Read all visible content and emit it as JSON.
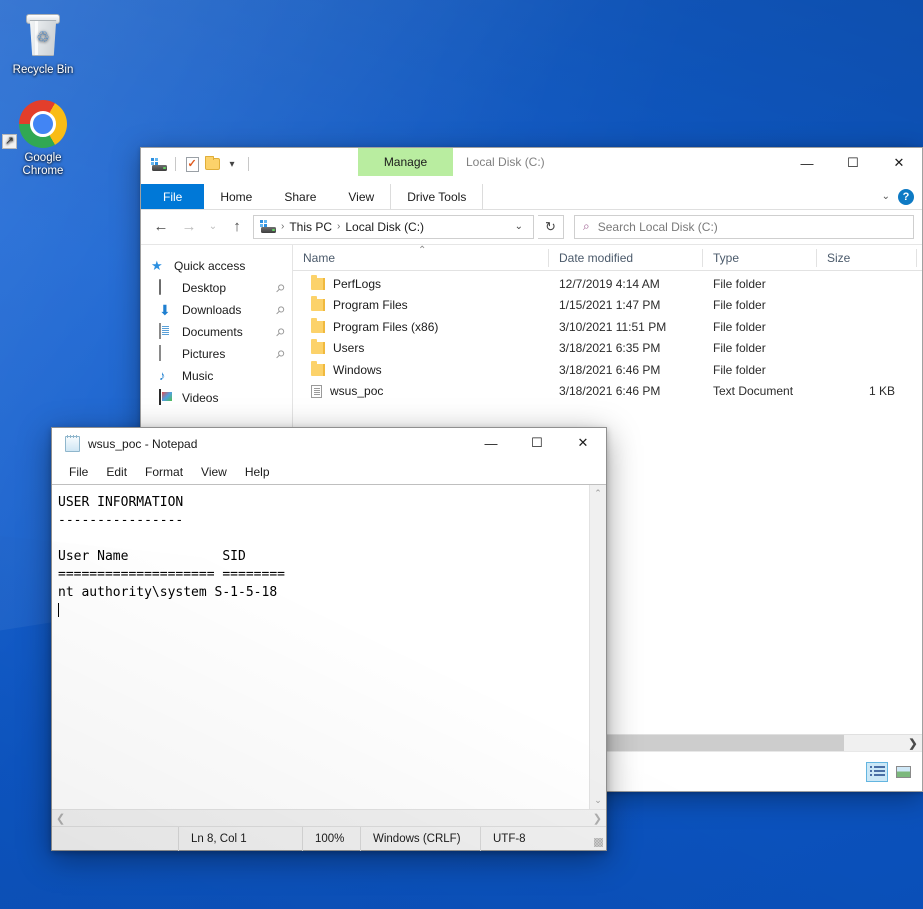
{
  "desktop": {
    "icons": [
      {
        "name": "recycle-bin",
        "label": "Recycle Bin"
      },
      {
        "name": "google-chrome",
        "label": "Google\nChrome",
        "label_line1": "Google",
        "label_line2": "Chrome"
      }
    ]
  },
  "explorer": {
    "window_title": "Local Disk (C:)",
    "contextual_tab_group": "Manage",
    "contextual_tab_color": "#b9eda0",
    "accent_color": "#0078d7",
    "quick_access_toolbar": [
      {
        "name": "drive-icon",
        "label": ""
      },
      {
        "name": "properties-icon",
        "label": ""
      },
      {
        "name": "new-folder-icon",
        "label": ""
      },
      {
        "name": "customize-chevron-icon",
        "label": "▾"
      }
    ],
    "tabs": [
      {
        "label": "File",
        "active_style": "file"
      },
      {
        "label": "Home"
      },
      {
        "label": "Share"
      },
      {
        "label": "View"
      },
      {
        "label": "Drive Tools",
        "contextual": true
      }
    ],
    "ribbon_collapse_chevron": "⌄",
    "help_button": "?",
    "navigation": {
      "back": "←",
      "forward": "→",
      "recent": "⌄",
      "up": "↑"
    },
    "address_bar": {
      "crumbs": [
        "This PC",
        "Local Disk (C:)"
      ],
      "separator": "›",
      "dropdown": "⌄",
      "refresh": "↻"
    },
    "search": {
      "placeholder": "Search Local Disk (C:)",
      "icon": "search-icon"
    },
    "nav_pane": {
      "root": {
        "label": "Quick access",
        "icon": "star-pin-icon"
      },
      "items": [
        {
          "label": "Desktop",
          "icon": "desktop-icon",
          "pinned": true
        },
        {
          "label": "Downloads",
          "icon": "download-icon",
          "pinned": true
        },
        {
          "label": "Documents",
          "icon": "documents-icon",
          "pinned": true
        },
        {
          "label": "Pictures",
          "icon": "pictures-icon",
          "pinned": true
        },
        {
          "label": "Music",
          "icon": "music-icon",
          "pinned": false
        },
        {
          "label": "Videos",
          "icon": "videos-icon",
          "pinned": false
        }
      ],
      "pin_glyph": "📌"
    },
    "columns": [
      {
        "label": "Name",
        "key": "name"
      },
      {
        "label": "Date modified",
        "key": "date"
      },
      {
        "label": "Type",
        "key": "type"
      },
      {
        "label": "Size",
        "key": "size"
      }
    ],
    "sort_indicator": "⌃",
    "files": [
      {
        "name": "PerfLogs",
        "date": "12/7/2019 4:14 AM",
        "type": "File folder",
        "size": "",
        "icon": "folder-icon"
      },
      {
        "name": "Program Files",
        "date": "1/15/2021 1:47 PM",
        "type": "File folder",
        "size": "",
        "icon": "folder-icon"
      },
      {
        "name": "Program Files (x86)",
        "date": "3/10/2021 11:51 PM",
        "type": "File folder",
        "size": "",
        "icon": "folder-icon"
      },
      {
        "name": "Users",
        "date": "3/18/2021 6:35 PM",
        "type": "File folder",
        "size": "",
        "icon": "folder-icon"
      },
      {
        "name": "Windows",
        "date": "3/18/2021 6:46 PM",
        "type": "File folder",
        "size": "",
        "icon": "folder-icon"
      },
      {
        "name": "wsus_poc",
        "date": "3/18/2021 6:46 PM",
        "type": "Text Document",
        "size": "1 KB",
        "icon": "text-document-icon"
      }
    ],
    "scroll_arrow": "❯",
    "view_buttons": [
      {
        "name": "details-view-button",
        "active": true
      },
      {
        "name": "large-icons-view-button",
        "active": false
      }
    ],
    "window_controls": {
      "minimize": "—",
      "maximize": "☐",
      "close": "✕"
    }
  },
  "notepad": {
    "title": "wsus_poc - Notepad",
    "menu": [
      "File",
      "Edit",
      "Format",
      "View",
      "Help"
    ],
    "content": "USER INFORMATION\n----------------\n\nUser Name            SID\n==================== ========\nnt authority\\system S-1-5-18\n",
    "status_bar": {
      "position": "Ln 8, Col 1",
      "zoom": "100%",
      "line_endings": "Windows (CRLF)",
      "encoding": "UTF-8"
    },
    "scroll": {
      "up": "⌃",
      "down": "⌄",
      "left": "❮",
      "right": "❯"
    },
    "window_controls": {
      "minimize": "—",
      "maximize": "☐",
      "close": "✕"
    }
  }
}
